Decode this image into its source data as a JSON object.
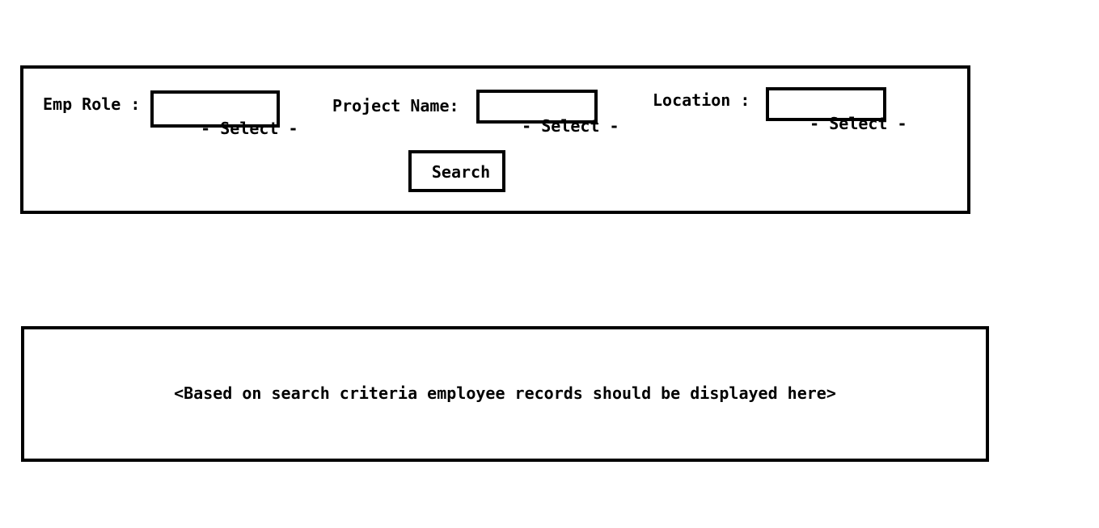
{
  "search_form": {
    "emp_role_label": "Emp Role :",
    "emp_role_value": "- Select -",
    "project_name_label": "Project Name:",
    "project_name_value": "- Select -",
    "location_label": "Location :",
    "location_value": "- Select -",
    "search_button_label": "Search"
  },
  "results": {
    "placeholder_text": "<Based on search criteria employee records should be displayed here>"
  },
  "colors": {
    "border": "#000000",
    "background": "#ffffff",
    "text": "#000000"
  }
}
